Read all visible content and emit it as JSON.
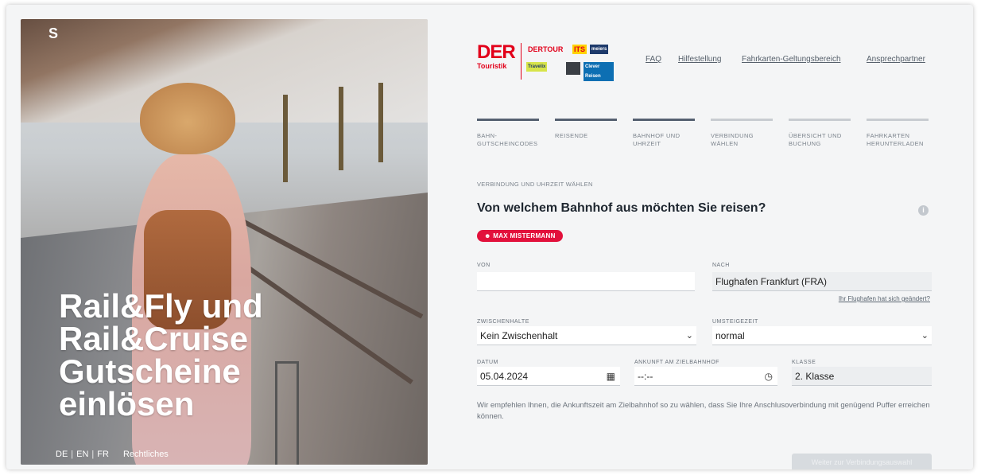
{
  "hero": {
    "corner_mark": "S",
    "title": "Rail&Fly und Rail&Cruise Gutscheine einlösen",
    "languages": [
      "DE",
      "EN",
      "FR"
    ],
    "legal_link": "Rechtliches"
  },
  "brand": {
    "main_logo": "DER",
    "main_logo_sub": "Touristik",
    "sub_brands": [
      "DERTOUR",
      "ITS",
      "meiers",
      "Travelix",
      "Clever Reisen"
    ],
    "accent_color": "#e2001a"
  },
  "nav": {
    "faq": "FAQ",
    "help": "Hilfestellung",
    "validity": "Fahrkarten-Geltungsbereich",
    "contact": "Ansprechpartner"
  },
  "steps": [
    {
      "label": "BAHN-GUTSCHEINCODES",
      "state": "done"
    },
    {
      "label": "REISENDE",
      "state": "done"
    },
    {
      "label": "BAHNHOF UND UHRZEIT",
      "state": "active"
    },
    {
      "label": "VERBINDUNG WÄHLEN",
      "state": "todo"
    },
    {
      "label": "ÜBERSICHT UND BUCHUNG",
      "state": "todo"
    },
    {
      "label": "FAHRKARTEN HERUNTERLADEN",
      "state": "todo"
    }
  ],
  "form": {
    "section_label": "VERBINDUNG UND UHRZEIT WÄHLEN",
    "question": "Von welchem Bahnhof aus möchten Sie reisen?",
    "traveler_badge": "MAX MISTERMANN",
    "von_label": "VON",
    "von_value": "",
    "nach_label": "NACH",
    "nach_value": "Flughafen Frankfurt (FRA)",
    "airport_changed_link": "Ihr Flughafen hat sich geändert?",
    "stops_label": "ZWISCHENHALTE",
    "stops_value": "Kein Zwischenhalt",
    "transfer_label": "UMSTEIGEZEIT",
    "transfer_value": "normal",
    "date_label": "DATUM",
    "date_value": "05.04.2024",
    "arrival_label": "ANKUNFT AM ZIELBAHNHOF",
    "arrival_value": "--:--",
    "class_label": "KLASSE",
    "class_value": "2. Klasse",
    "hint": "Wir empfehlen Ihnen, die Ankunftszeit am Zielbahnhof so zu wählen, dass Sie Ihre Anschlusoverbindung mit genügend Puffer erreichen können.",
    "next_button": "Weiter zur Verbindungsauswahl"
  }
}
